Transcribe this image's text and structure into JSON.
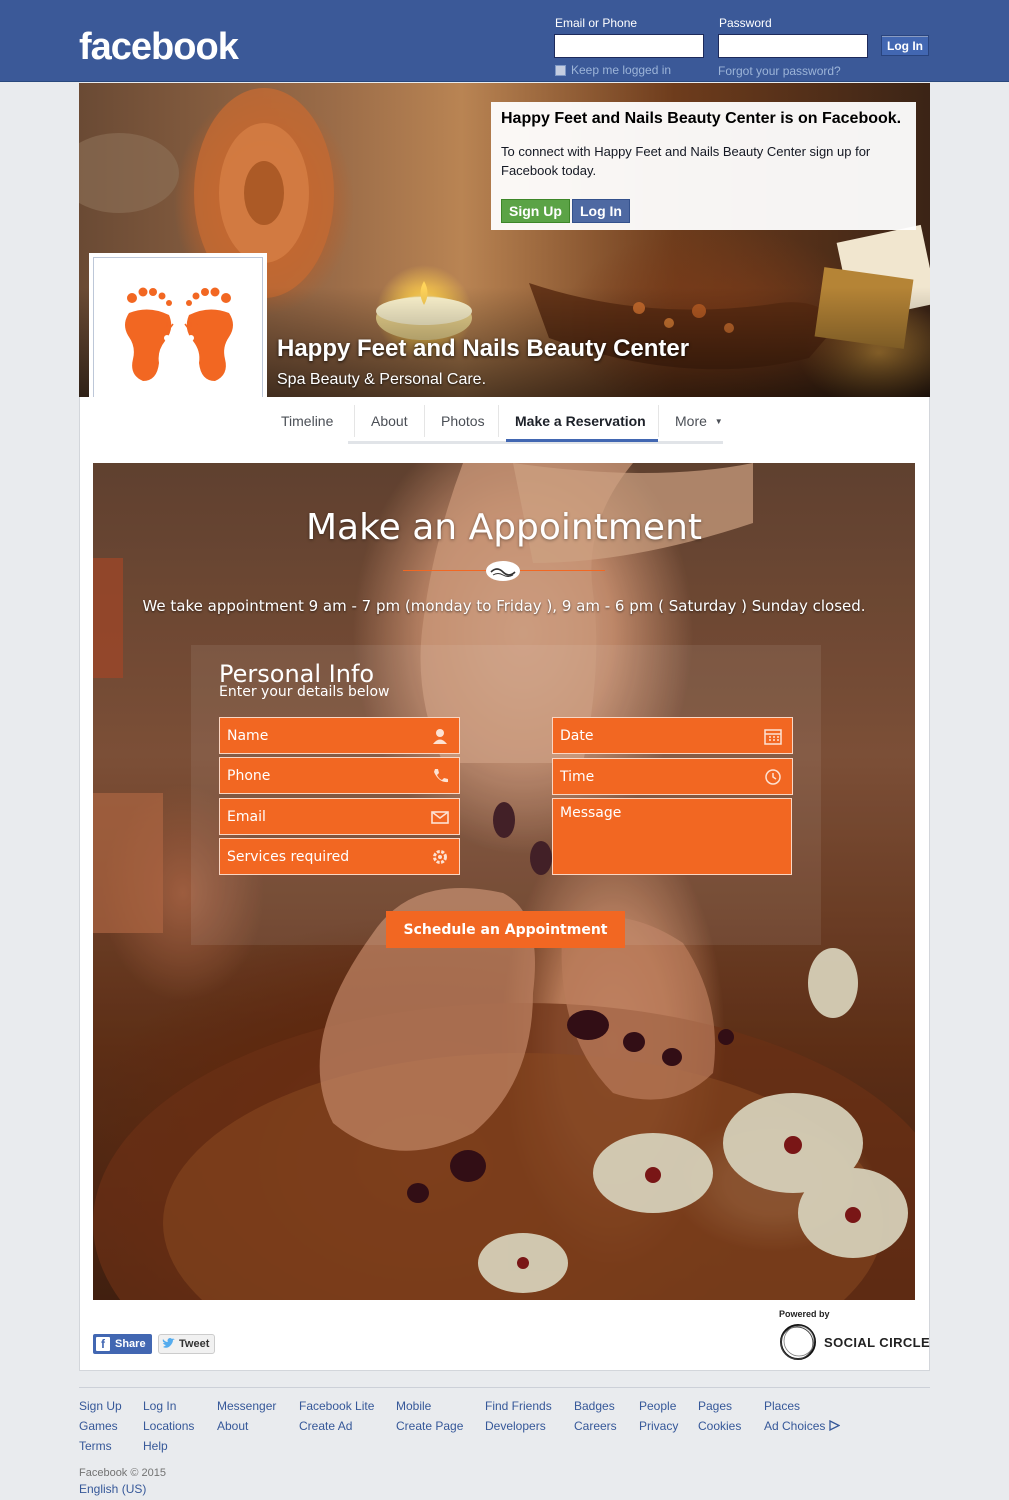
{
  "header": {
    "logo": "facebook",
    "email_label": "Email or Phone",
    "password_label": "Password",
    "login_button": "Log In",
    "keep_logged_in": "Keep me logged in",
    "forgot_password": "Forgot your password?",
    "bar_color": "#3b5998"
  },
  "cover": {
    "join_title": "Happy Feet and Nails Beauty Center is on Facebook.",
    "join_text": "To connect with Happy Feet and Nails Beauty Center sign up for Facebook today.",
    "signup_button": "Sign Up",
    "login_button": "Log In",
    "page_name": "Happy Feet and Nails Beauty Center",
    "page_category": "Spa Beauty & Personal Care."
  },
  "tabs": {
    "timeline": "Timeline",
    "about": "About",
    "photos": "Photos",
    "reservation": "Make a Reservation",
    "more": "More",
    "active": "reservation"
  },
  "appointment": {
    "title": "Make an Appointment",
    "hours": "We take appointment 9 am - 7 pm (monday to Friday ), 9 am - 6 pm ( Saturday ) Sunday closed.",
    "section_title": "Personal Info",
    "section_subtitle": "Enter your details below",
    "fields": {
      "name": "Name",
      "phone": "Phone",
      "email": "Email",
      "services": "Services required",
      "date": "Date",
      "time": "Time",
      "message": "Message"
    },
    "submit": "Schedule an Appointment",
    "accent_color": "#f26722"
  },
  "share": {
    "share_label": "Share",
    "tweet_label": "Tweet",
    "powered_by": "Powered by",
    "powered_brand": "SOCIAL CIRCLE"
  },
  "footer": {
    "links": {
      "sign_up": "Sign Up",
      "log_in": "Log In",
      "messenger": "Messenger",
      "facebook_lite": "Facebook Lite",
      "mobile": "Mobile",
      "find_friends": "Find Friends",
      "badges": "Badges",
      "people": "People",
      "pages": "Pages",
      "places": "Places",
      "games": "Games",
      "locations": "Locations",
      "about": "About",
      "create_ad": "Create Ad",
      "create_page": "Create Page",
      "developers": "Developers",
      "careers": "Careers",
      "privacy": "Privacy",
      "cookies": "Cookies",
      "ad_choices": "Ad Choices",
      "terms": "Terms",
      "help": "Help"
    },
    "copyright": "Facebook © 2015",
    "language": "English (US)"
  }
}
